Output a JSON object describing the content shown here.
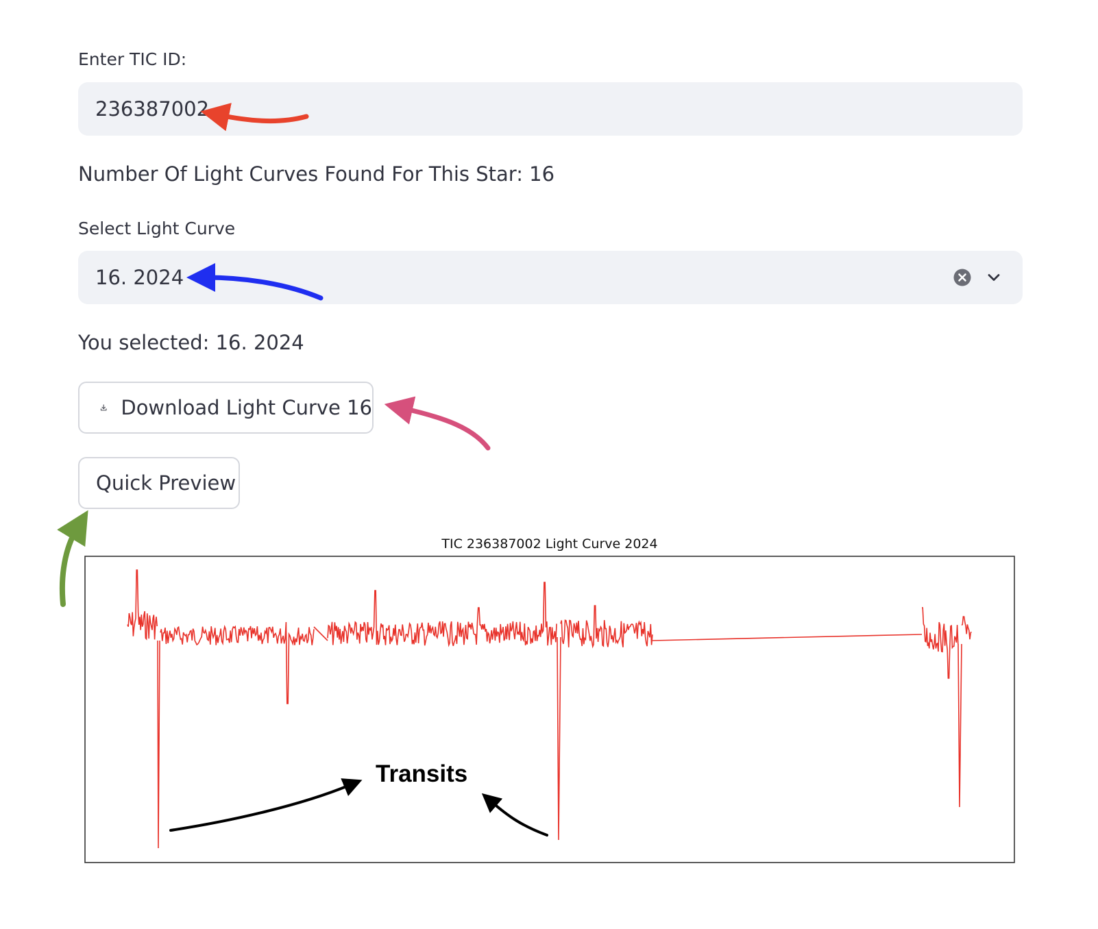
{
  "tic_input": {
    "label": "Enter TIC ID:",
    "value": "236387002"
  },
  "count_text": "Number Of Light Curves Found For This Star: 16",
  "select": {
    "label": "Select Light Curve",
    "value": "16. 2024"
  },
  "selected_text": "You selected: 16. 2024",
  "buttons": {
    "download_label": "Download Light Curve 16",
    "preview_label": "Quick Preview"
  },
  "icons": [
    "download-icon",
    "clear-icon",
    "chevron-down-icon"
  ],
  "colors": {
    "field_bg": "#f0f2f6",
    "curve": "#e8322a",
    "arrow_red": "#e8432c",
    "arrow_blue": "#1f2ef0",
    "arrow_pink": "#d6507c",
    "arrow_green": "#6e9a3e"
  },
  "chart_data": {
    "type": "line",
    "title": "TIC 236387002 Light Curve 2024",
    "annotation": "Transits",
    "axes_visible": false,
    "series": [
      {
        "color": "#e8322a",
        "transits": [
          0.032,
          0.5,
          0.958
        ]
      }
    ]
  }
}
